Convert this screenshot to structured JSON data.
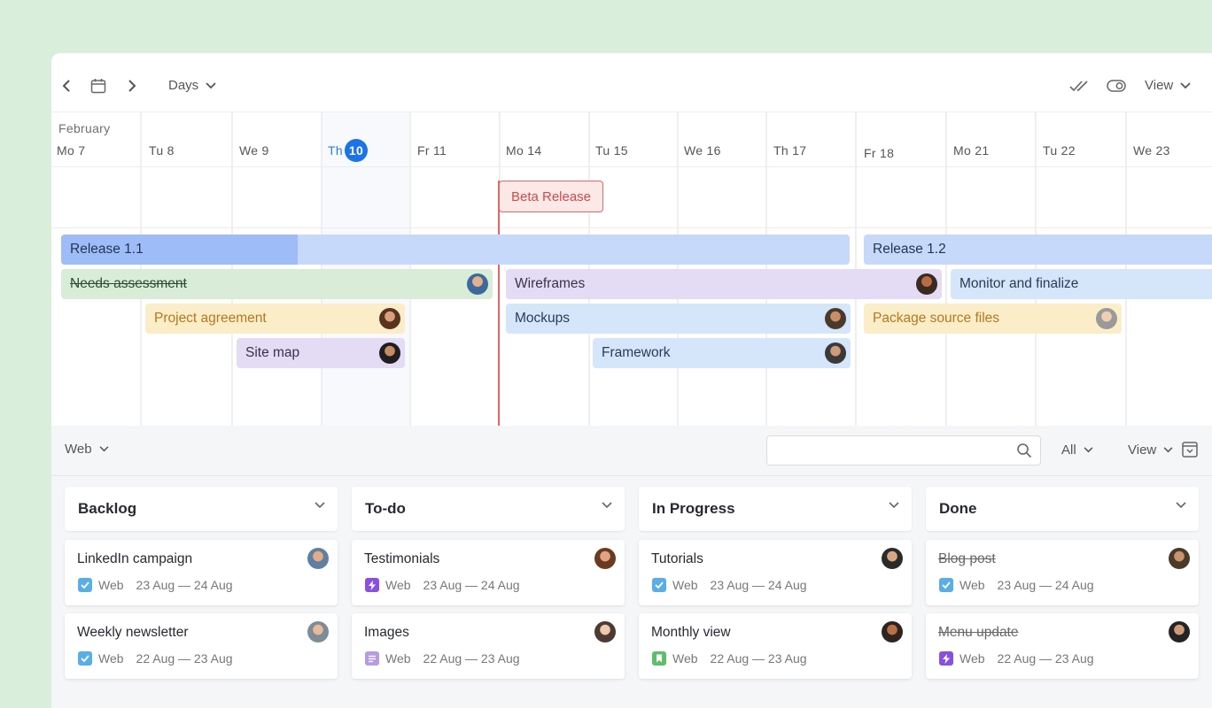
{
  "toolbar": {
    "scale_label": "Days",
    "view_label": "View"
  },
  "timeline": {
    "month": "February",
    "days": [
      "Mo 7",
      "Tu 8",
      "We 9",
      "Fr 11",
      "Mo 14",
      "Tu 15",
      "We 16",
      "Th 17",
      "Fr 18",
      "Mo 21",
      "Tu 22",
      "We 23"
    ],
    "today": {
      "weekday": "Th",
      "num": "10"
    },
    "milestone": "Beta Release",
    "bars": {
      "release_11": "Release 1.1",
      "release_12": "Release 1.2",
      "needs_assessment": "Needs assessment",
      "wireframes": "Wireframes",
      "monitor": "Monitor and finalize",
      "project_agreement": "Project agreement",
      "mockups": "Mockups",
      "package_source": "Package source files",
      "site_map": "Site map",
      "framework": "Framework"
    }
  },
  "board": {
    "project_label": "Web",
    "search_placeholder": "",
    "filter_label": "All",
    "view_label": "View",
    "columns": [
      {
        "title": "Backlog",
        "cards": [
          {
            "title": "LinkedIn campaign",
            "type": "Web",
            "dates": "23 Aug — 24 Aug"
          },
          {
            "title": "Weekly newsletter",
            "type": "Web",
            "dates": "22 Aug — 23 Aug"
          }
        ]
      },
      {
        "title": "To-do",
        "cards": [
          {
            "title": "Testimonials",
            "type": "Web",
            "dates": "23 Aug — 24 Aug"
          },
          {
            "title": "Images",
            "type": "Web",
            "dates": "22 Aug — 23 Aug"
          }
        ]
      },
      {
        "title": "In Progress",
        "cards": [
          {
            "title": "Tutorials",
            "type": "Web",
            "dates": "23 Aug — 24 Aug"
          },
          {
            "title": "Monthly view",
            "type": "Web",
            "dates": "22 Aug — 23 Aug"
          }
        ]
      },
      {
        "title": "Done",
        "cards": [
          {
            "title": "Blog post",
            "type": "Web",
            "dates": "23 Aug — 24 Aug"
          },
          {
            "title": "Menu update",
            "type": "Web",
            "dates": "22 Aug — 23 Aug"
          }
        ]
      }
    ]
  },
  "colors": {
    "accent": "#1a73e8",
    "milestone": "#e06a6a",
    "task_check": "#5aaee8",
    "task_bolt": "#8b4fe0",
    "task_doc": "#b59be6",
    "task_bookmark": "#5cc068"
  }
}
